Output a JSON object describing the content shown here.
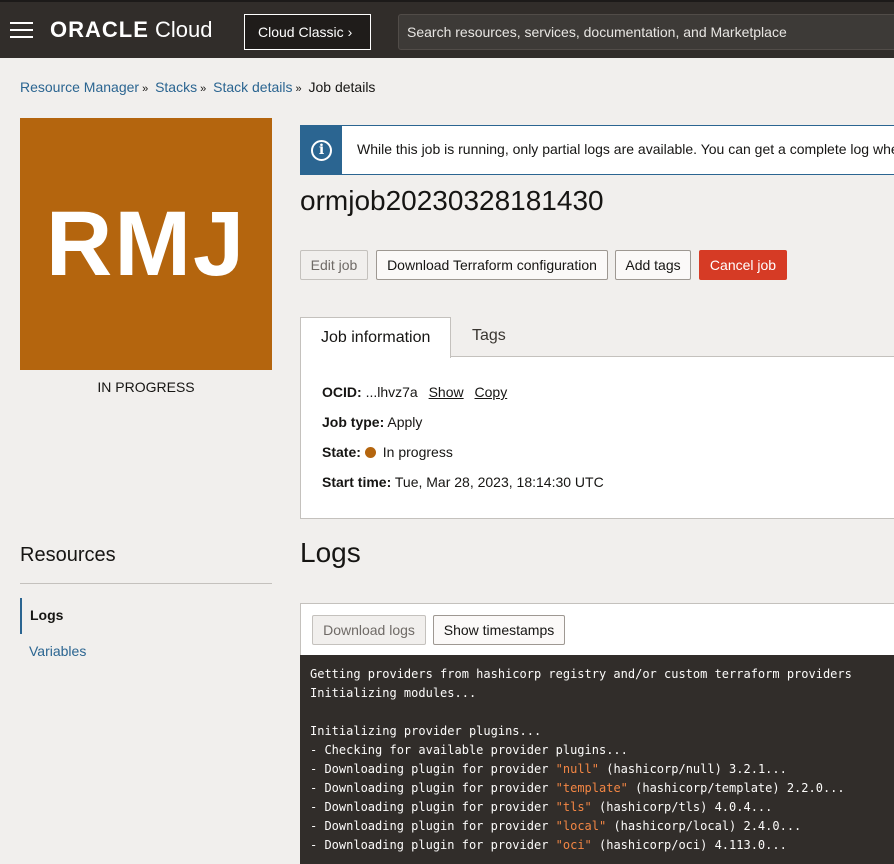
{
  "header": {
    "brand_oracle": "ORACLE",
    "brand_cloud": "Cloud",
    "classic_label": "Cloud Classic",
    "classic_chevron": "›",
    "search_placeholder": "Search resources, services, documentation, and Marketplace"
  },
  "breadcrumb": {
    "items": [
      "Resource Manager",
      "Stacks",
      "Stack details"
    ],
    "current": "Job details",
    "separator": "»"
  },
  "badge": {
    "initials": "RMJ",
    "state": "IN PROGRESS",
    "color": "#b4650e"
  },
  "banner": {
    "icon": "info-icon",
    "text": "While this job is running, only partial logs are available. You can get a complete log when the job finishes."
  },
  "job": {
    "title": "ormjob20230328181430"
  },
  "actions": {
    "edit": "Edit job",
    "download_tf": "Download Terraform configuration",
    "add_tags": "Add tags",
    "cancel": "Cancel job"
  },
  "tabs": {
    "info": "Job information",
    "tags": "Tags"
  },
  "info": {
    "ocid_label": "OCID:",
    "ocid_value": "...lhvz7a",
    "show": "Show",
    "copy": "Copy",
    "job_type_label": "Job type:",
    "job_type_value": "Apply",
    "state_label": "State:",
    "state_value": "In progress",
    "start_label": "Start time:",
    "start_value": "Tue, Mar 28, 2023, 18:14:30 UTC"
  },
  "resources": {
    "title": "Resources",
    "items": [
      "Logs",
      "Variables"
    ]
  },
  "logs": {
    "title": "Logs",
    "download": "Download logs",
    "timestamps": "Show timestamps",
    "lines": [
      {
        "pre": "Getting providers from hashicorp registry and/or custom terraform providers"
      },
      {
        "pre": "Initializing modules..."
      },
      {
        "pre": ""
      },
      {
        "pre": "Initializing provider plugins..."
      },
      {
        "pre": "- Checking for available provider plugins..."
      },
      {
        "pre": "- Downloading plugin for provider ",
        "hl": "\"null\"",
        "post": " (hashicorp/null) 3.2.1..."
      },
      {
        "pre": "- Downloading plugin for provider ",
        "hl": "\"template\"",
        "post": " (hashicorp/template) 2.2.0..."
      },
      {
        "pre": "- Downloading plugin for provider ",
        "hl": "\"tls\"",
        "post": " (hashicorp/tls) 4.0.4..."
      },
      {
        "pre": "- Downloading plugin for provider ",
        "hl": "\"local\"",
        "post": " (hashicorp/local) 2.4.0..."
      },
      {
        "pre": "- Downloading plugin for provider ",
        "hl": "\"oci\"",
        "post": " (hashicorp/oci) 4.113.0..."
      }
    ]
  }
}
